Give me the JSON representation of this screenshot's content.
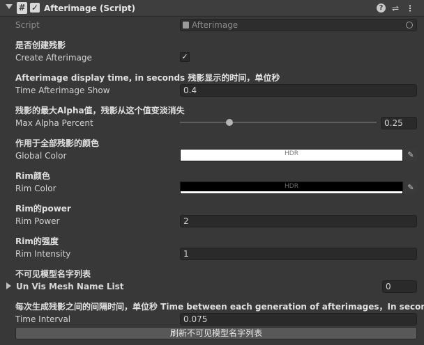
{
  "header": {
    "title": "Afterimage (Script)"
  },
  "script": {
    "label": "Script",
    "value": "Afterimage"
  },
  "create": {
    "header": "是否创建残影",
    "label": "Create Afterimage",
    "checked": true
  },
  "show_time": {
    "header": "Afterimage display time, in seconds 残影显示的时间，单位秒",
    "label": "Time Afterimage Show",
    "value": "0.4"
  },
  "alpha": {
    "header": "残影的最大Alpha值，残影从这个值变淡消失",
    "label": "Max Alpha Percent",
    "value": "0.25",
    "fraction": 0.25
  },
  "global_color": {
    "header": "作用于全部残影的颜色",
    "label": "Global Color",
    "hdr": "HDR",
    "color": "#ffffff"
  },
  "rim_color": {
    "header": "Rim颜色",
    "label": "Rim Color",
    "hdr": "HDR",
    "color": "#000000"
  },
  "rim_power": {
    "header": "Rim的power",
    "label": "Rim Power",
    "value": "2"
  },
  "rim_intensity": {
    "header": "Rim的强度",
    "label": "Rim Intensity",
    "value": "1"
  },
  "list": {
    "header": "不可见模型名字列表",
    "label": "Un Vis Mesh Name List",
    "count": "0"
  },
  "interval": {
    "header": "每次生成残影之间的间隔时间，单位秒 Time between each generation of afterimages，In seconds",
    "label": "Time Interval",
    "value": "0.075"
  },
  "refresh_button": "刷新不可见模型名字列表"
}
